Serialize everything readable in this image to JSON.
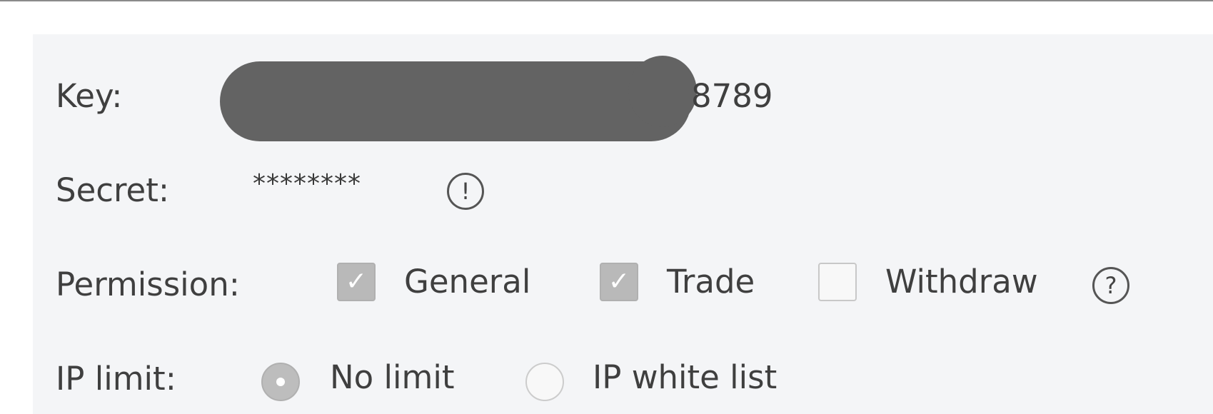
{
  "key": {
    "label": "Key:",
    "suffix": "8789"
  },
  "secret": {
    "label": "Secret:",
    "masked_value": "********",
    "info_icon": "exclamation-circle-icon",
    "info_glyph": "!"
  },
  "permission": {
    "label": "Permission:",
    "options": [
      {
        "label": "General",
        "checked": true
      },
      {
        "label": "Trade",
        "checked": true
      },
      {
        "label": "Withdraw",
        "checked": false
      }
    ],
    "help_icon": "question-circle-icon",
    "help_glyph": "?",
    "check_glyph": "✓"
  },
  "ip_limit": {
    "label": "IP limit:",
    "options": [
      {
        "label": "No limit",
        "selected": true
      },
      {
        "label": "IP white list",
        "selected": false
      }
    ]
  }
}
